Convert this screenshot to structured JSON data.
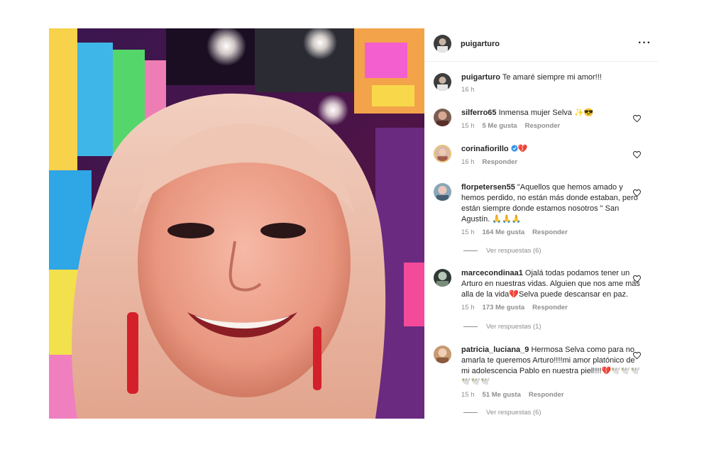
{
  "post": {
    "author": "puigarturo",
    "more_icon": "more-horizontal-icon",
    "caption_user": "puigarturo",
    "caption_text": "Te amaré siempre mi amor!!!",
    "caption_time": "16 h"
  },
  "comments": [
    {
      "user": "silferro65",
      "text": "Inmensa mujer Selva ✨😎",
      "time": "15 h",
      "likes": "5 Me gusta",
      "reply": "Responder",
      "verified": false
    },
    {
      "user": "corinafiorillo",
      "text": "💔",
      "time": "16 h",
      "likes": "",
      "reply": "Responder",
      "verified": true
    },
    {
      "user": "florpetersen55",
      "text": "\"Aquellos que hemos amado y hemos perdido, no están más donde estaban, pero están siempre donde estamos nosotros \" San Agustín. 🙏🙏🙏",
      "time": "15 h",
      "likes": "164 Me gusta",
      "reply": "Responder",
      "view_replies": "Ver respuestas (6)",
      "verified": false
    },
    {
      "user": "marcecondinaa1",
      "text": "Ojalá todas podamos tener un Arturo en nuestras vidas. Alguien que nos ame más alla de la vida💔Selva puede descansar en paz.",
      "time": "15 h",
      "likes": "173 Me gusta",
      "reply": "Responder",
      "view_replies": "Ver respuestas (1)",
      "verified": false
    },
    {
      "user": "patricia_luciana_9",
      "text": "Hermosa Selva como para no amarla te queremos Arturo!!!!mi amor platónico de mi adolescencia Pablo en nuestra piel!!!!💔🕊️🕊️🕊️🕊️🕊️🕊️",
      "time": "15 h",
      "likes": "51 Me gusta",
      "reply": "Responder",
      "view_replies": "Ver respuestas (6)",
      "verified": false
    }
  ],
  "colors": {
    "text": "#262626",
    "muted": "#8e8e8e",
    "verified": "#3897f0",
    "divider": "#efefef"
  }
}
